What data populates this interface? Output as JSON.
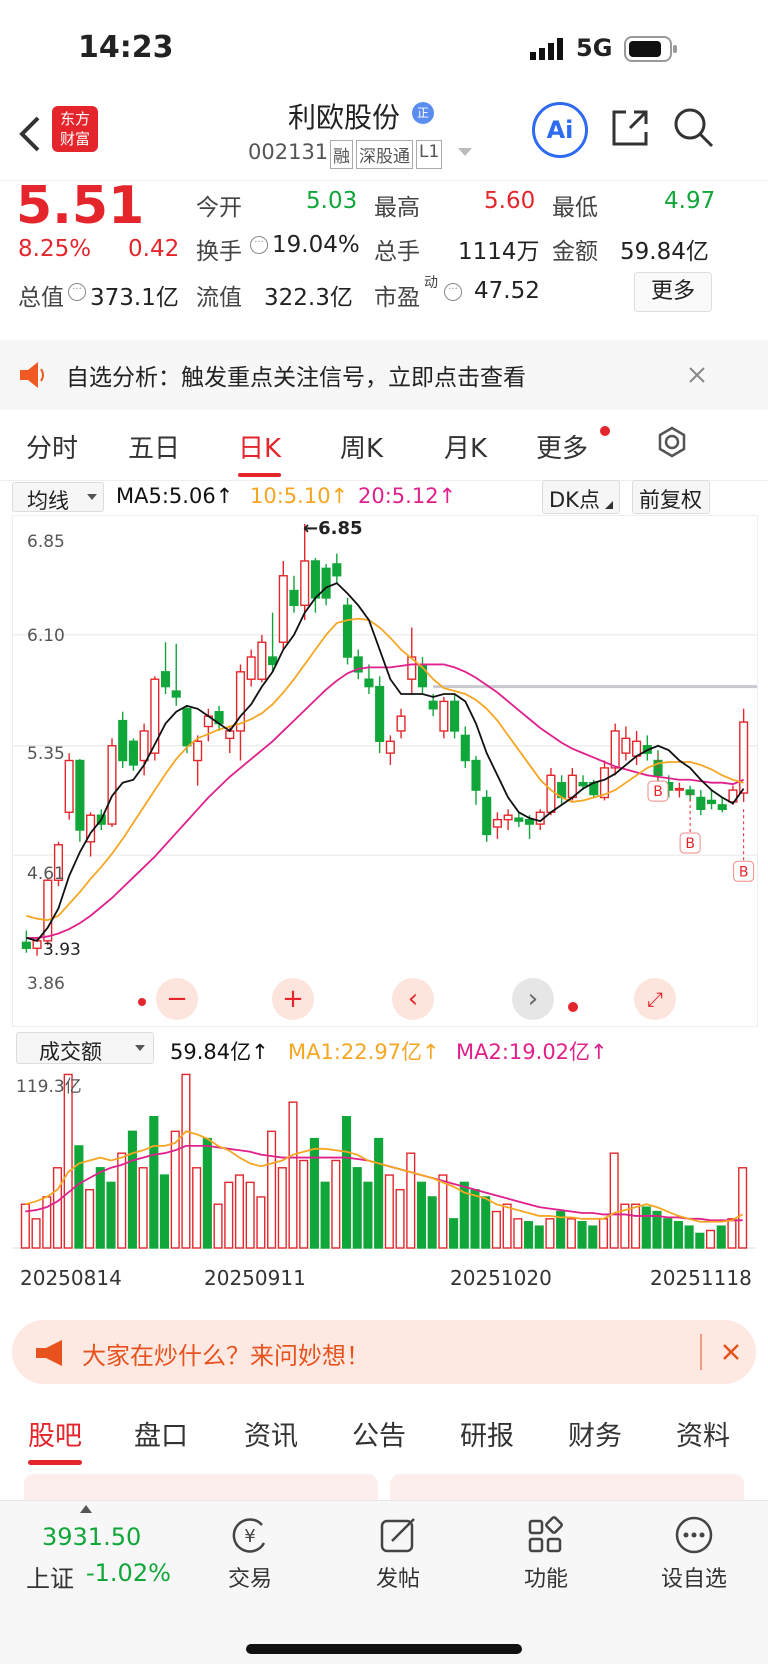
{
  "status": {
    "time": "14:23",
    "network": "5G"
  },
  "header": {
    "brand_logo": "东方\n财富",
    "stock_name": "利欧股份",
    "stock_code": "002131",
    "tags": [
      "融",
      "深股通",
      "L1"
    ],
    "ai_label": "Ai"
  },
  "quote": {
    "price": "5.51",
    "change_pct": "8.25%",
    "change": "0.42",
    "open_label": "今开",
    "open": "5.03",
    "high_label": "最高",
    "high": "5.60",
    "low_label": "最低",
    "low": "4.97",
    "turnover_label": "换手",
    "turnover": "19.04%",
    "volume_label": "总手",
    "volume": "1114万",
    "amount_label": "金额",
    "amount": "59.84亿",
    "mktcap_label": "总值",
    "mktcap": "373.1亿",
    "float_label": "流值",
    "float": "322.3亿",
    "pe_label": "市盈",
    "pe_sup": "动",
    "pe": "47.52",
    "more_button": "更多"
  },
  "banner": {
    "text": "自选分析：触发重点关注信号，立即点击查看"
  },
  "tabs": {
    "items": [
      "分时",
      "五日",
      "日K",
      "周K",
      "月K",
      "更多"
    ],
    "active": 2
  },
  "indicator": {
    "selector": "均线",
    "ma5": "MA5:5.06↑",
    "ma10": "10:5.10↑",
    "ma20": "20:5.12↑",
    "dk": "DK点",
    "adjust": "前复权"
  },
  "chart_data": [
    {
      "type": "candlestick",
      "y_labels": [
        "6.85",
        "6.10",
        "5.35",
        "4.61",
        "3.86"
      ],
      "ylim": [
        3.86,
        6.85
      ],
      "max_label": "←6.85",
      "min_label": "3.93",
      "colors": {
        "up": "#e4262c",
        "down": "#11a63a",
        "ma5": "#111111",
        "ma10": "#f5a623",
        "ma20": "#e0208c"
      },
      "candles": [
        {
          "o": 4.02,
          "h": 4.1,
          "l": 3.95,
          "c": 3.98
        },
        {
          "o": 3.98,
          "h": 4.05,
          "l": 3.93,
          "c": 4.03
        },
        {
          "o": 4.03,
          "h": 4.45,
          "l": 4.0,
          "c": 4.44
        },
        {
          "o": 4.44,
          "h": 4.7,
          "l": 4.4,
          "c": 4.68
        },
        {
          "o": 4.9,
          "h": 5.3,
          "l": 4.85,
          "c": 5.25
        },
        {
          "o": 5.25,
          "h": 5.26,
          "l": 4.7,
          "c": 4.78
        },
        {
          "o": 4.7,
          "h": 4.9,
          "l": 4.6,
          "c": 4.88
        },
        {
          "o": 4.88,
          "h": 4.92,
          "l": 4.78,
          "c": 4.82
        },
        {
          "o": 4.82,
          "h": 5.4,
          "l": 4.8,
          "c": 5.35
        },
        {
          "o": 5.52,
          "h": 5.58,
          "l": 5.2,
          "c": 5.25
        },
        {
          "o": 5.38,
          "h": 5.4,
          "l": 5.18,
          "c": 5.22
        },
        {
          "o": 5.25,
          "h": 5.5,
          "l": 5.15,
          "c": 5.45
        },
        {
          "o": 5.3,
          "h": 5.82,
          "l": 5.25,
          "c": 5.8
        },
        {
          "o": 5.85,
          "h": 6.05,
          "l": 5.7,
          "c": 5.75
        },
        {
          "o": 5.72,
          "h": 6.04,
          "l": 5.62,
          "c": 5.68
        },
        {
          "o": 5.6,
          "h": 5.62,
          "l": 5.3,
          "c": 5.35
        },
        {
          "o": 5.25,
          "h": 5.42,
          "l": 5.08,
          "c": 5.38
        },
        {
          "o": 5.48,
          "h": 5.6,
          "l": 5.38,
          "c": 5.55
        },
        {
          "o": 5.58,
          "h": 5.62,
          "l": 5.45,
          "c": 5.5
        },
        {
          "o": 5.4,
          "h": 5.48,
          "l": 5.3,
          "c": 5.45
        },
        {
          "o": 5.45,
          "h": 5.9,
          "l": 5.25,
          "c": 5.85
        },
        {
          "o": 5.8,
          "h": 6.0,
          "l": 5.75,
          "c": 5.95
        },
        {
          "o": 5.8,
          "h": 6.1,
          "l": 5.78,
          "c": 6.05
        },
        {
          "o": 5.95,
          "h": 6.25,
          "l": 5.85,
          "c": 5.9
        },
        {
          "o": 6.05,
          "h": 6.6,
          "l": 6.0,
          "c": 6.5
        },
        {
          "o": 6.4,
          "h": 6.5,
          "l": 6.25,
          "c": 6.3
        },
        {
          "o": 6.3,
          "h": 6.85,
          "l": 6.2,
          "c": 6.6
        },
        {
          "o": 6.6,
          "h": 6.62,
          "l": 6.25,
          "c": 6.35
        },
        {
          "o": 6.55,
          "h": 6.58,
          "l": 6.3,
          "c": 6.35
        },
        {
          "o": 6.58,
          "h": 6.65,
          "l": 6.45,
          "c": 6.5
        },
        {
          "o": 6.3,
          "h": 6.35,
          "l": 5.9,
          "c": 5.95
        },
        {
          "o": 5.95,
          "h": 6.0,
          "l": 5.8,
          "c": 5.85
        },
        {
          "o": 5.8,
          "h": 5.9,
          "l": 5.7,
          "c": 5.75
        },
        {
          "o": 5.75,
          "h": 5.82,
          "l": 5.3,
          "c": 5.38
        },
        {
          "o": 5.3,
          "h": 5.42,
          "l": 5.22,
          "c": 5.38
        },
        {
          "o": 5.45,
          "h": 5.6,
          "l": 5.4,
          "c": 5.55
        },
        {
          "o": 5.8,
          "h": 6.15,
          "l": 5.7,
          "c": 5.95
        },
        {
          "o": 5.9,
          "h": 5.95,
          "l": 5.7,
          "c": 5.75
        },
        {
          "o": 5.65,
          "h": 5.7,
          "l": 5.55,
          "c": 5.6
        },
        {
          "o": 5.45,
          "h": 5.68,
          "l": 5.4,
          "c": 5.65
        },
        {
          "o": 5.65,
          "h": 5.7,
          "l": 5.4,
          "c": 5.45
        },
        {
          "o": 5.42,
          "h": 5.48,
          "l": 5.2,
          "c": 5.25
        },
        {
          "o": 5.25,
          "h": 5.28,
          "l": 4.95,
          "c": 5.05
        },
        {
          "o": 5.0,
          "h": 5.05,
          "l": 4.7,
          "c": 4.75
        },
        {
          "o": 4.8,
          "h": 4.9,
          "l": 4.72,
          "c": 4.85
        },
        {
          "o": 4.85,
          "h": 4.92,
          "l": 4.78,
          "c": 4.88
        },
        {
          "o": 4.86,
          "h": 4.9,
          "l": 4.8,
          "c": 4.84
        },
        {
          "o": 4.85,
          "h": 4.88,
          "l": 4.72,
          "c": 4.82
        },
        {
          "o": 4.82,
          "h": 4.92,
          "l": 4.78,
          "c": 4.9
        },
        {
          "o": 4.9,
          "h": 5.2,
          "l": 4.88,
          "c": 5.15
        },
        {
          "o": 5.1,
          "h": 5.15,
          "l": 4.95,
          "c": 5.0
        },
        {
          "o": 5.0,
          "h": 5.2,
          "l": 4.98,
          "c": 5.15
        },
        {
          "o": 5.1,
          "h": 5.15,
          "l": 5.05,
          "c": 5.08
        },
        {
          "o": 5.1,
          "h": 5.12,
          "l": 5.0,
          "c": 5.02
        },
        {
          "o": 5.0,
          "h": 5.25,
          "l": 4.98,
          "c": 5.2
        },
        {
          "o": 5.2,
          "h": 5.5,
          "l": 5.15,
          "c": 5.45
        },
        {
          "o": 5.3,
          "h": 5.48,
          "l": 5.25,
          "c": 5.4
        },
        {
          "o": 5.28,
          "h": 5.45,
          "l": 5.22,
          "c": 5.38
        },
        {
          "o": 5.35,
          "h": 5.42,
          "l": 5.25,
          "c": 5.3
        },
        {
          "o": 5.25,
          "h": 5.32,
          "l": 5.1,
          "c": 5.15
        },
        {
          "o": 5.1,
          "h": 5.15,
          "l": 5.0,
          "c": 5.05
        },
        {
          "o": 5.05,
          "h": 5.1,
          "l": 5.0,
          "c": 5.06
        },
        {
          "o": 5.05,
          "h": 5.08,
          "l": 4.98,
          "c": 5.02
        },
        {
          "o": 5.0,
          "h": 5.05,
          "l": 4.88,
          "c": 4.92
        },
        {
          "o": 4.98,
          "h": 5.05,
          "l": 4.92,
          "c": 4.96
        },
        {
          "o": 4.95,
          "h": 5.0,
          "l": 4.9,
          "c": 4.92
        },
        {
          "o": 4.97,
          "h": 5.08,
          "l": 4.95,
          "c": 5.05
        },
        {
          "o": 5.03,
          "h": 5.6,
          "l": 4.97,
          "c": 5.51
        }
      ],
      "ma5": [
        4.05,
        4.03,
        4.12,
        4.25,
        4.47,
        4.63,
        4.76,
        4.85,
        5.01,
        5.1,
        5.12,
        5.22,
        5.36,
        5.5,
        5.58,
        5.62,
        5.6,
        5.55,
        5.5,
        5.45,
        5.55,
        5.63,
        5.75,
        5.85,
        6.0,
        6.1,
        6.25,
        6.35,
        6.42,
        6.45,
        6.38,
        6.3,
        6.2,
        6.0,
        5.8,
        5.7,
        5.7,
        5.7,
        5.68,
        5.7,
        5.7,
        5.65,
        5.5,
        5.3,
        5.15,
        5.0,
        4.9,
        4.86,
        4.84,
        4.9,
        4.95,
        5.0,
        5.06,
        5.1,
        5.12,
        5.16,
        5.22,
        5.28,
        5.32,
        5.35,
        5.32,
        5.25,
        5.2,
        5.12,
        5.05,
        5.0,
        4.96,
        5.06
      ],
      "ma10": [
        4.2,
        4.18,
        4.17,
        4.2,
        4.28,
        4.36,
        4.45,
        4.53,
        4.62,
        4.72,
        4.83,
        4.94,
        5.05,
        5.16,
        5.26,
        5.34,
        5.4,
        5.43,
        5.46,
        5.48,
        5.5,
        5.53,
        5.57,
        5.63,
        5.71,
        5.8,
        5.9,
        6.0,
        6.1,
        6.18,
        6.2,
        6.21,
        6.2,
        6.15,
        6.08,
        6.0,
        5.94,
        5.88,
        5.8,
        5.74,
        5.72,
        5.7,
        5.66,
        5.6,
        5.52,
        5.42,
        5.32,
        5.22,
        5.12,
        5.05,
        5.0,
        4.97,
        4.98,
        5.0,
        5.02,
        5.05,
        5.1,
        5.15,
        5.2,
        5.23,
        5.24,
        5.24,
        5.24,
        5.22,
        5.19,
        5.15,
        5.12,
        5.1
      ],
      "ma20": [
        4.05,
        4.05,
        4.06,
        4.08,
        4.11,
        4.15,
        4.2,
        4.26,
        4.32,
        4.39,
        4.46,
        4.53,
        4.6,
        4.68,
        4.76,
        4.84,
        4.92,
        5.0,
        5.07,
        5.14,
        5.2,
        5.26,
        5.32,
        5.38,
        5.45,
        5.52,
        5.59,
        5.66,
        5.73,
        5.79,
        5.84,
        5.87,
        5.88,
        5.88,
        5.88,
        5.89,
        5.9,
        5.9,
        5.9,
        5.9,
        5.88,
        5.85,
        5.81,
        5.76,
        5.71,
        5.65,
        5.59,
        5.53,
        5.47,
        5.42,
        5.37,
        5.33,
        5.3,
        5.27,
        5.24,
        5.21,
        5.19,
        5.17,
        5.15,
        5.14,
        5.13,
        5.12,
        5.12,
        5.11,
        5.1,
        5.1,
        5.09,
        5.12
      ]
    },
    {
      "type": "bar",
      "title": "成交额",
      "value_label": "59.84亿↑",
      "ma1_label": "MA1:22.97亿↑",
      "ma2_label": "MA2:19.02亿↑",
      "ylabel_top": "119.3亿",
      "ylim": [
        0,
        119.3
      ],
      "x_labels": [
        "20250814",
        "20250911",
        "20251020",
        "20251118"
      ],
      "colors": {
        "up": "#e4262c",
        "down": "#11a63a",
        "ma1": "#f5a623",
        "ma2": "#e0208c"
      },
      "values": [
        30,
        20,
        35,
        55,
        119,
        70,
        40,
        55,
        45,
        65,
        80,
        55,
        90,
        50,
        80,
        119,
        55,
        75,
        30,
        45,
        50,
        45,
        35,
        80,
        55,
        100,
        60,
        75,
        45,
        60,
        90,
        55,
        45,
        75,
        50,
        40,
        65,
        45,
        35,
        50,
        20,
        45,
        40,
        35,
        25,
        30,
        20,
        18,
        15,
        20,
        25,
        20,
        18,
        15,
        20,
        65,
        30,
        30,
        28,
        25,
        20,
        18,
        15,
        10,
        12,
        15,
        20,
        55
      ],
      "up": [
        1,
        1,
        1,
        1,
        1,
        0,
        1,
        0,
        0,
        1,
        0,
        1,
        0,
        0,
        1,
        1,
        1,
        0,
        1,
        1,
        1,
        1,
        1,
        1,
        1,
        1,
        1,
        0,
        0,
        1,
        0,
        0,
        0,
        0,
        1,
        1,
        1,
        0,
        0,
        1,
        0,
        0,
        0,
        0,
        1,
        1,
        1,
        0,
        0,
        1,
        0,
        1,
        0,
        0,
        1,
        1,
        1,
        1,
        0,
        0,
        0,
        0,
        0,
        0,
        1,
        0,
        1,
        1
      ],
      "ma1": [
        30,
        32,
        35,
        40,
        52,
        58,
        60,
        62,
        60,
        62,
        65,
        67,
        70,
        70,
        72,
        80,
        78,
        75,
        70,
        67,
        62,
        58,
        56,
        58,
        60,
        64,
        66,
        68,
        68,
        67,
        66,
        64,
        60,
        58,
        56,
        54,
        52,
        50,
        48,
        45,
        42,
        38,
        36,
        34,
        30,
        28,
        26,
        24,
        22,
        22,
        21,
        21,
        20,
        20,
        20,
        24,
        26,
        28,
        30,
        28,
        25,
        22,
        20,
        18,
        18,
        18,
        19,
        23
      ],
      "ma2": [
        25,
        26,
        28,
        32,
        38,
        44,
        48,
        52,
        55,
        57,
        60,
        62,
        64,
        65,
        67,
        70,
        70,
        70,
        69,
        68,
        67,
        66,
        64,
        63,
        62,
        62,
        62,
        62,
        62,
        62,
        62,
        61,
        60,
        58,
        56,
        54,
        52,
        50,
        48,
        46,
        44,
        42,
        40,
        38,
        36,
        34,
        32,
        30,
        28,
        27,
        26,
        25,
        24,
        24,
        23,
        23,
        23,
        22,
        22,
        22,
        21,
        21,
        20,
        20,
        19,
        19,
        19,
        19
      ]
    }
  ],
  "ask": {
    "text": "大家在炒什么？来问妙想！"
  },
  "bottom_tabs": {
    "items": [
      "股吧",
      "盘口",
      "资讯",
      "公告",
      "研报",
      "财务",
      "资料"
    ],
    "active": 0
  },
  "nav": {
    "index_value": "3931.50",
    "index_name": "上证",
    "index_change": "-1.02%",
    "trade": "交易",
    "post": "发帖",
    "functions": "功能",
    "watchlist": "设自选"
  }
}
